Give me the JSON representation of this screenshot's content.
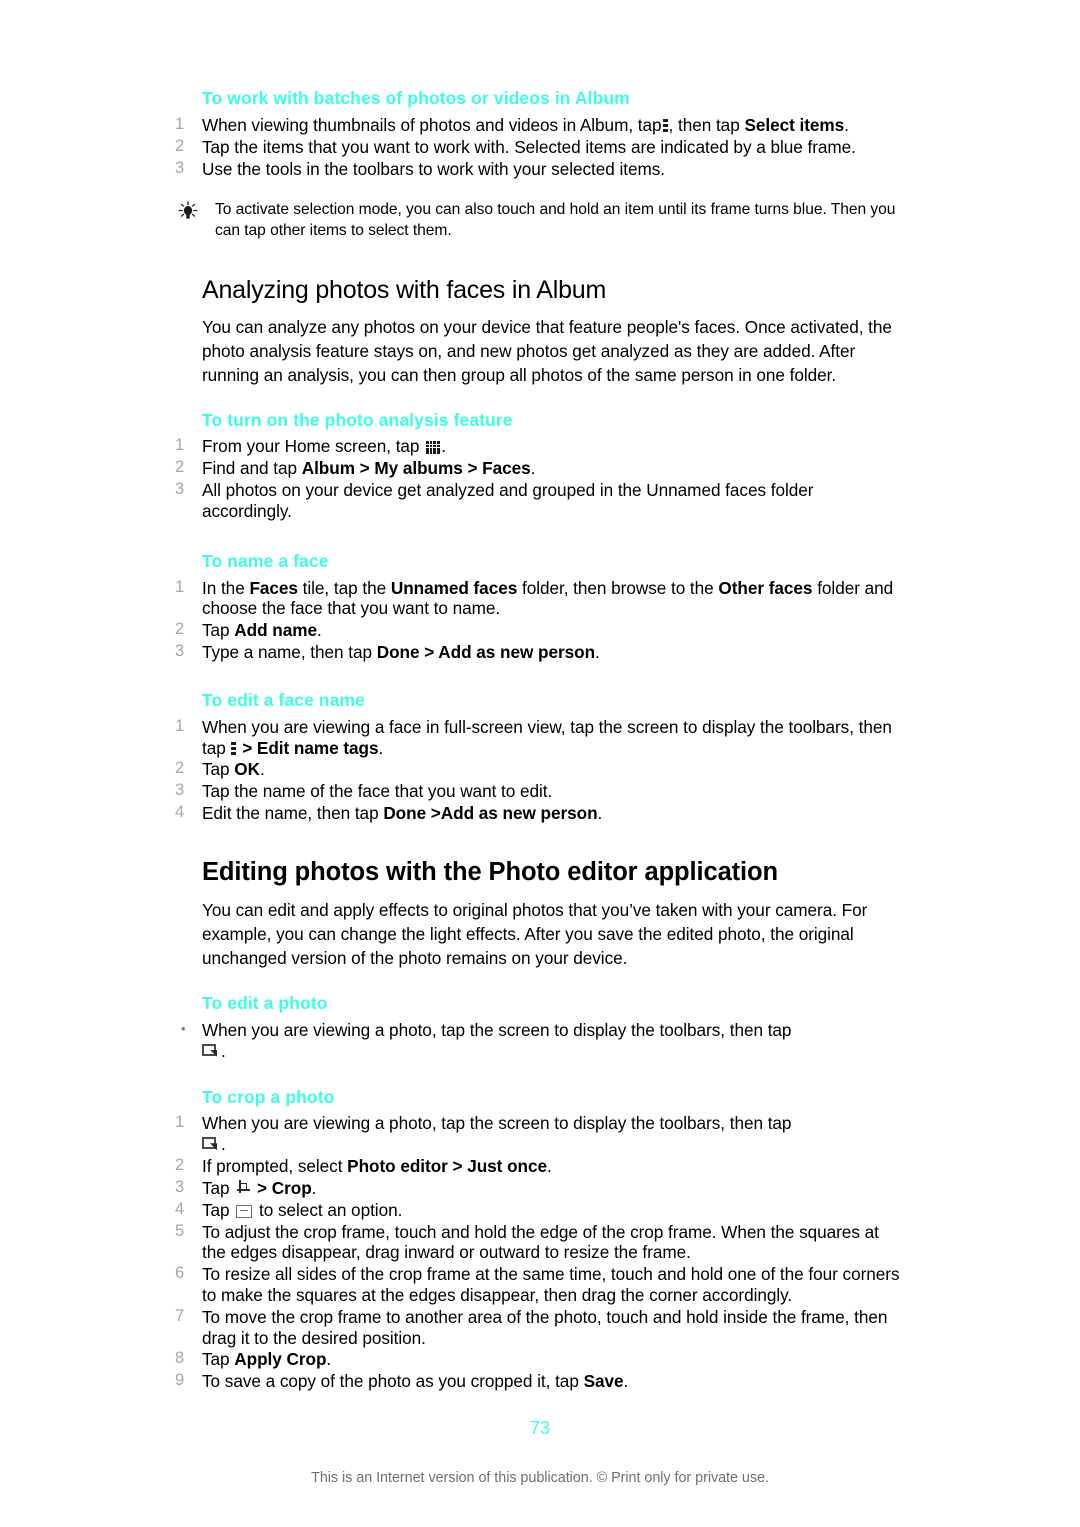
{
  "page": {
    "number": "73",
    "footer_note": "This is an Internet version of this publication. © Print only for private use."
  },
  "sections": [
    {
      "id": "batches",
      "heading": "To work with batches of photos or videos in Album",
      "steps": [
        {
          "num": "1",
          "text_parts": [
            "When viewing thumbnails of photos and videos in Album, tap ",
            "more-vertical-icon",
            ", then tap ",
            "Select items",
            "."
          ]
        },
        {
          "num": "2",
          "text": "Tap the items that you want to work with. Selected items are indicated by a blue frame."
        },
        {
          "num": "3",
          "text": "Use the tools in the toolbars to work with your selected items."
        }
      ],
      "tip": "To activate selection mode, you can also touch and hold an item until its frame turns blue. Then you can tap other items to select them."
    },
    {
      "id": "analyzing",
      "title": "Analyzing photos with faces in Album",
      "intro": "You can analyze any photos on your device that feature people's faces. Once activated, the photo analysis feature stays on, and new photos get analyzed as they are added. After running an analysis, you can then group all photos of the same person in one folder."
    },
    {
      "id": "photo-analysis",
      "heading": "To turn on the photo analysis feature",
      "steps": [
        {
          "num": "1",
          "text": "From your Home screen, tap "
        },
        {
          "num": "2",
          "text": "Find and tap ",
          "bold1": "Album > My albums > Faces",
          "tail": "."
        },
        {
          "num": "3",
          "text": "All photos on your device get analyzed and grouped in the Unnamed faces folder accordingly."
        }
      ]
    },
    {
      "id": "name-face",
      "heading": "To name a face",
      "steps": [
        {
          "num": "1",
          "text": "In the Faces tile, tap the Unnamed faces folder, then browse to the Other faces folder and choose the face that you want to name."
        },
        {
          "num": "2",
          "text": "Tap Add name."
        },
        {
          "num": "3",
          "text": "Type a name, then tap Done > Add as new person."
        }
      ]
    },
    {
      "id": "edit-face-name",
      "heading": "To edit a face name",
      "steps": [
        {
          "num": "1",
          "text": "When you are viewing a face in full-screen view, tap the screen to display the toolbars, then tap  > Edit name tags."
        },
        {
          "num": "2",
          "text": "Tap OK."
        },
        {
          "num": "3",
          "text": "Tap the name of the face that you want to edit."
        },
        {
          "num": "4",
          "text": "Edit the name, then tap Done >Add as new person."
        }
      ]
    },
    {
      "id": "photo-editor",
      "title": "Editing photos with the Photo editor application",
      "intro": "You can edit and apply effects to original photos that you’ve taken with your camera. For example, you can change the light effects. After you save the edited photo, the original unchanged version of the photo remains on your device."
    },
    {
      "id": "edit-photo",
      "heading": "To edit a photo",
      "steps": [
        {
          "bullet": "•",
          "text": "When you are viewing a photo, tap the screen to display the toolbars, then tap"
        }
      ]
    },
    {
      "id": "crop-photo",
      "heading": "To crop a photo",
      "steps": [
        {
          "num": "1",
          "text": "When you are viewing a photo, tap the screen to display the toolbars, then tap"
        },
        {
          "num": "2",
          "text": "If prompted, select Photo editor > Just once."
        },
        {
          "num": "3",
          "text": "Tap  > Crop."
        },
        {
          "num": "4",
          "text": "Tap  to select an option."
        },
        {
          "num": "5",
          "text": "To adjust the crop frame, touch and hold the edge of the crop frame. When the squares at the edges disappear, drag inward or outward to resize the frame."
        },
        {
          "num": "6",
          "text": "To resize all sides of the crop frame at the same time, touch and hold one of the four corners to make the squares at the edges disappear, then drag the corner accordingly."
        },
        {
          "num": "7",
          "text": "To move the crop frame to another area of the photo, touch and hold inside the frame, then drag it to the desired position."
        },
        {
          "num": "8",
          "text": "Tap Apply Crop."
        },
        {
          "num": "9",
          "text": "To save a copy of the photo as you cropped it, tap Save."
        }
      ]
    }
  ],
  "text": {
    "s1_heading": "To work with batches of photos or videos in Album",
    "s1_step1_a": "When viewing thumbnails of photos and videos in Album, tap",
    "s1_step1_b": ", then tap",
    "s1_step1_bold": "Select items",
    "s1_step1_c": ".",
    "s1_step2": "Tap the items that you want to work with. Selected items are indicated by a blue frame.",
    "s1_step3": "Use the tools in the toolbars to work with your selected items.",
    "s1_tip": "To activate selection mode, you can also touch and hold an item until its frame turns blue. Then you can tap other items to select them.",
    "s2_title": "Analyzing photos with faces in Album",
    "s2_intro": "You can analyze any photos on your device that feature people's faces. Once activated, the photo analysis feature stays on, and new photos get analyzed as they are added. After running an analysis, you can then group all photos of the same person in one folder.",
    "s3_heading": "To turn on the photo analysis feature",
    "s3_step1_a": "From your Home screen, tap",
    "s3_step1_b": ".",
    "s3_step2_a": "Find and tap",
    "s3_step2_bold": "Album > My albums > Faces",
    "s3_step2_c": ".",
    "s3_step3": "All photos on your device get analyzed and grouped in the Unnamed faces folder accordingly.",
    "s4_heading": "To name a face",
    "s4_step1_a": "In the",
    "s4_step1_b1": "Faces",
    "s4_step1_c": "tile, tap the",
    "s4_step1_b2": "Unnamed faces",
    "s4_step1_d": "folder, then browse to the",
    "s4_step1_b3": "Other faces",
    "s4_step1_e": "folder and choose the face that you want to name.",
    "s4_step2_a": "Tap",
    "s4_step2_bold": "Add name",
    "s4_step2_c": ".",
    "s4_step3_a": "Type a name, then tap",
    "s4_step3_bold": "Done > Add as new person",
    "s4_step3_c": ".",
    "s5_heading": "To edit a face name",
    "s5_step1_a": "When you are viewing a face in full-screen view, tap the screen to display the toolbars, then tap",
    "s5_step1_bold": "> Edit name tags",
    "s5_step1_c": ".",
    "s5_step2_a": "Tap",
    "s5_step2_bold": "OK",
    "s5_step2_c": ".",
    "s5_step3": "Tap the name of the face that you want to edit.",
    "s5_step4_a": "Edit the name, then tap",
    "s5_step4_bold": "Done >Add as new person",
    "s5_step4_c": ".",
    "s6_title": "Editing photos with the Photo editor application",
    "s6_intro": "You can edit and apply effects to original photos that you’ve taken with your camera. For example, you can change the light effects. After you save the edited photo, the original unchanged version of the photo remains on your device.",
    "s7_heading": "To edit a photo",
    "s7_bullet": "•",
    "s7_step1": "When you are viewing a photo, tap the screen to display the toolbars, then tap",
    "s7_step1_end": ".",
    "s8_heading": "To crop a photo",
    "s8_step1": "When you are viewing a photo, tap the screen to display the toolbars, then tap",
    "s8_step1_end": ".",
    "s8_step2_a": "If prompted, select",
    "s8_step2_bold": "Photo editor > Just once",
    "s8_step2_c": ".",
    "s8_step3_a": "Tap",
    "s8_step3_bold": "> Crop",
    "s8_step3_c": ".",
    "s8_step4_a": "Tap",
    "s8_step4_b": "to select an option.",
    "s8_step5": "To adjust the crop frame, touch and hold the edge of the crop frame. When the squares at the edges disappear, drag inward or outward to resize the frame.",
    "s8_step6": "To resize all sides of the crop frame at the same time, touch and hold one of the four corners to make the squares at the edges disappear, then drag the corner accordingly.",
    "s8_step7": "To move the crop frame to another area of the photo, touch and hold inside the frame, then drag it to the desired position.",
    "s8_step8_a": "Tap",
    "s8_step8_bold": "Apply Crop",
    "s8_step8_c": ".",
    "s8_step9_a": "To save a copy of the photo as you cropped it, tap",
    "s8_step9_bold": "Save",
    "s8_step9_c": "."
  },
  "numbers": {
    "n1": "1",
    "n2": "2",
    "n3": "3",
    "n4": "4",
    "n5": "5",
    "n6": "6",
    "n7": "7",
    "n8": "8",
    "n9": "9"
  },
  "colors": {
    "accent": "#3dfde2",
    "body_text": "#000000",
    "step_number": "#a6a6a6",
    "footer": "#6f6f6f"
  }
}
